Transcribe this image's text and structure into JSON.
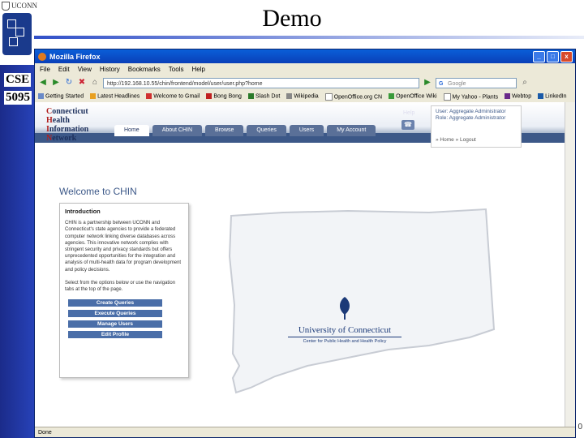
{
  "slide": {
    "title": "Demo",
    "brand": "UCONN",
    "course_line1": "CSE",
    "course_line2": "5095",
    "slide_number": "0"
  },
  "browser": {
    "window_title": "Mozilla Firefox",
    "window_controls": [
      "_",
      "□",
      "x"
    ],
    "menu": [
      "File",
      "Edit",
      "View",
      "History",
      "Bookmarks",
      "Tools",
      "Help"
    ],
    "url": "http://192.168.10.55/chin/frontend/model/user/user.php?home",
    "search_placeholder": "Google",
    "bookmarks": [
      "Getting Started",
      "Latest Headlines",
      "Welcome to Gmail",
      "Bong Bong",
      "Slash Dot",
      "Wikipedia",
      "OpenOffice.org CN",
      "OpenOffice Wiki",
      "My Yahoo - Plants",
      "Webtop",
      "LinkedIn"
    ],
    "status": "Done"
  },
  "site": {
    "logo_lines": [
      {
        "cap": "C",
        "rest": "onnecticut"
      },
      {
        "cap": "H",
        "rest": "ealth"
      },
      {
        "cap": "I",
        "rest": "nformation"
      },
      {
        "cap": "N",
        "rest": "etwork"
      }
    ],
    "tabs": [
      "Home",
      "About CHIN",
      "Browse",
      "Queries",
      "Users",
      "My Account"
    ],
    "help": "Help",
    "user": {
      "user_line": "User: Aggregate Administrator",
      "role_line": "Role: Aggregate Administrator",
      "links": "» Home   » Logout"
    },
    "welcome": "Welcome to CHIN",
    "intro": {
      "heading": "Introduction",
      "para1": "CHIN is a partnership between UCONN and Connecticut's state agencies to provide a federated computer network linking diverse databases across agencies. This innovative network complies with stringent security and privacy standards but offers unprecedented opportunities for the integration and analysis of multi-health data for program development and policy decisions.",
      "para2": "Select from the options below or use the navigation tabs at the top of the page."
    },
    "actions": [
      "Create Queries",
      "Execute Queries",
      "Manage Users",
      "Edit Profile"
    ],
    "uconn_name": "University of Connecticut",
    "uconn_sub": "Center for Public Health and Health Policy"
  }
}
